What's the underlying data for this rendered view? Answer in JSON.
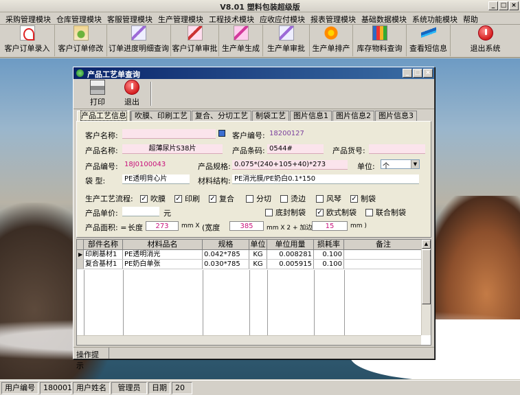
{
  "app": {
    "title": "V8.01 塑料包装超级版"
  },
  "menu": [
    "采购管理模块",
    "仓库管理模块",
    "客服管理模块",
    "生产管理模块",
    "工程技术模块",
    "应收应付模块",
    "报表管理模块",
    "基础数据模块",
    "系统功能模块",
    "帮助"
  ],
  "toolbar": [
    {
      "label": "客户订单录入",
      "icon": "pdf-icon"
    },
    {
      "label": "客户订单修改",
      "icon": "plant-icon"
    },
    {
      "label": "订单进度明细查询",
      "icon": "pen-icon"
    },
    {
      "label": "客户订单审批",
      "icon": "approve-icon"
    },
    {
      "label": "生产单生成",
      "icon": "generate-icon"
    },
    {
      "label": "生产单审批",
      "icon": "pen-icon"
    },
    {
      "label": "生产单排产",
      "icon": "flower-icon"
    },
    {
      "label": "库存物料查询",
      "icon": "books-icon"
    },
    {
      "label": "查看短信息",
      "icon": "feather-icon"
    },
    {
      "label": "退出系统",
      "icon": "exit-icon"
    }
  ],
  "child": {
    "title": "产品工艺单查询",
    "toolbar": {
      "print": "打印",
      "exit": "退出"
    },
    "tabs": [
      "产品工艺信息",
      "吹膜、印刷工艺",
      "复合、分切工艺",
      "制袋工艺",
      "图片信息1",
      "图片信息2",
      "图片信息3"
    ],
    "form": {
      "customer_name_label": "客户名称:",
      "customer_name": "",
      "customer_no_label": "客户编号:",
      "customer_no": "18200127",
      "product_name_label": "产品名称:",
      "product_name": "超薄尿片S38片",
      "barcode_label": "产品条码:",
      "barcode": "0544#",
      "goods_no_label": "产品货号:",
      "goods_no": "",
      "product_no_label": "产品编号:",
      "product_no": "18J0100043",
      "spec_label": "产品规格:",
      "spec": "0.075*(240+105+40)*273",
      "unit_label": "单位:",
      "unit": "个",
      "bag_type_label": "袋 型:",
      "bag_type": "PE透明背心片",
      "material_label": "材料结构:",
      "material": "PE消光膜/PE奶白0.1*150",
      "process_label": "生产工艺流程:",
      "process": [
        {
          "label": "吹膜",
          "checked": true
        },
        {
          "label": "印刷",
          "checked": true
        },
        {
          "label": "复合",
          "checked": true
        },
        {
          "label": "分切",
          "checked": false
        },
        {
          "label": "烫边",
          "checked": false
        },
        {
          "label": "风琴",
          "checked": false
        },
        {
          "label": "制袋",
          "checked": true
        }
      ],
      "bag_options": [
        {
          "label": "底封制袋",
          "checked": false
        },
        {
          "label": "欧式制袋",
          "checked": true
        },
        {
          "label": "联合制袋",
          "checked": false
        }
      ],
      "price_label": "产品单价:",
      "price": "",
      "price_unit": "元",
      "area_label": "产品面积: =",
      "length_label": "长度",
      "length": "273",
      "mm_x1": "mm X",
      "width_label": "(宽度",
      "width": "385",
      "mm_x2": "mm X 2 + 加边",
      "edge": "15",
      "mm_close": "mm )"
    },
    "grid": {
      "columns": [
        "部件名称",
        "材料品名",
        "规格",
        "单位",
        "单位用量",
        "损耗率",
        "备注"
      ],
      "rows": [
        {
          "part": "印刷基材1",
          "material": "PE透明消光",
          "spec": "0.042*785",
          "unit": "KG",
          "usage": "0.008281",
          "loss": "0.100",
          "note": ""
        },
        {
          "part": "复合基材1",
          "material": "PE奶白单张",
          "spec": "0.030*785",
          "unit": "KG",
          "usage": "0.005915",
          "loss": "0.100",
          "note": ""
        }
      ]
    },
    "status": "操作提示"
  },
  "statusbar": {
    "user_no_label": "用户编号",
    "user_no": "180001",
    "user_name_label": "用户姓名",
    "user_name": "管理员",
    "date_label": "日期",
    "date": "20"
  }
}
